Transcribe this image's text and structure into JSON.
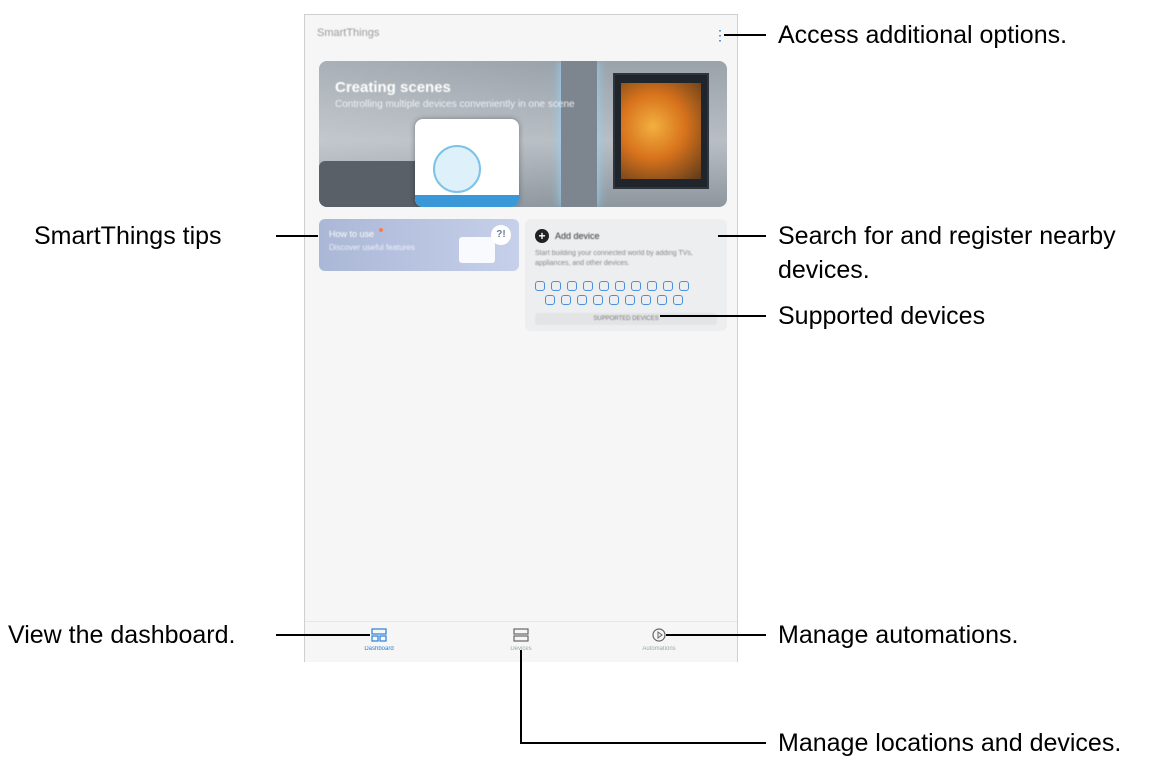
{
  "app": {
    "title": "SmartThings",
    "more_icon": "more-vertical-icon"
  },
  "banner": {
    "title": "Creating scenes",
    "subtitle": "Controlling multiple devices conveniently in one scene"
  },
  "tip_card": {
    "title": "How to use",
    "subtitle": "Discover useful features",
    "bubble_text": "?!"
  },
  "add_card": {
    "label": "Add device",
    "description": "Start building your connected world by adding TVs, appliances, and other devices.",
    "supported_label": "SUPPORTED DEVICES"
  },
  "bottom_nav": {
    "items": [
      {
        "label": "Dashboard",
        "icon": "dashboard-icon",
        "active": true
      },
      {
        "label": "Devices",
        "icon": "devices-icon",
        "active": false
      },
      {
        "label": "Automations",
        "icon": "automations-icon",
        "active": false
      }
    ]
  },
  "callouts": {
    "options": "Access additional options.",
    "tips": "SmartThings tips",
    "search_line1": "Search for and register nearby",
    "search_line2": "devices.",
    "supported": "Supported devices",
    "dashboard": "View the dashboard.",
    "automations": "Manage automations.",
    "locations": "Manage locations and devices."
  }
}
